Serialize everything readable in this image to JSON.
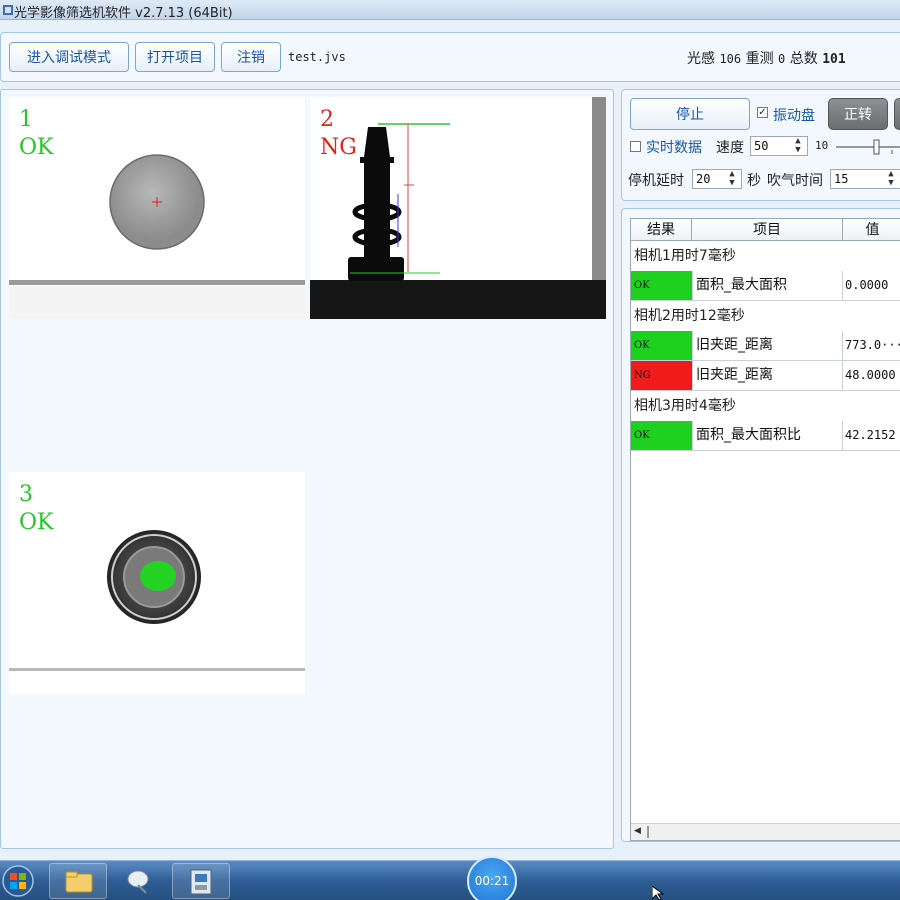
{
  "window": {
    "title": "光学影像筛选机软件 v2.7.13 (64Bit)"
  },
  "toolbar": {
    "debug_mode_label": "进入调试模式",
    "open_project_label": "打开项目",
    "logout_label": "注销",
    "project_file": "test.jvs"
  },
  "stats": {
    "light_label": "光感",
    "light_value": "106",
    "retest_label": "重测",
    "retest_value": "0",
    "total_label": "总数",
    "total_value": "101"
  },
  "cameras": [
    {
      "index": "1",
      "status": "OK",
      "status_color": "#22c922"
    },
    {
      "index": "2",
      "status": "NG",
      "status_color": "#e0241a"
    },
    {
      "index": "3",
      "status": "OK",
      "status_color": "#22c922"
    }
  ],
  "controls": {
    "stop_label": "停止",
    "vibration_label": "振动盘",
    "vibration_checked": true,
    "forward_label": "正转",
    "realtime_label": "实时数据",
    "realtime_checked": false,
    "speed_label": "速度",
    "speed_value": "50",
    "slider_value": "10",
    "stop_delay_label": "停机延时",
    "stop_delay_value": "20",
    "seconds_label": "秒",
    "blow_time_label": "吹气时间",
    "blow_time_value": "15"
  },
  "results": {
    "columns": [
      "结果",
      "项目",
      "值"
    ],
    "groups": [
      {
        "title": "相机1用时7毫秒",
        "rows": [
          {
            "result": "OK",
            "item": "面积_最大面积",
            "value": "0.0000"
          }
        ]
      },
      {
        "title": "相机2用时12毫秒",
        "rows": [
          {
            "result": "OK",
            "item": "旧夹距_距离",
            "value": "773.0···"
          },
          {
            "result": "NG",
            "item": "旧夹距_距离",
            "value": "48.0000"
          }
        ]
      },
      {
        "title": "相机3用时4毫秒",
        "rows": [
          {
            "result": "OK",
            "item": "面积_最大面积比",
            "value": "42.2152"
          }
        ]
      }
    ],
    "ok_color": "#1fd11f",
    "ng_color": "#f01c1c"
  },
  "taskbar": {
    "timer": "00:21"
  }
}
